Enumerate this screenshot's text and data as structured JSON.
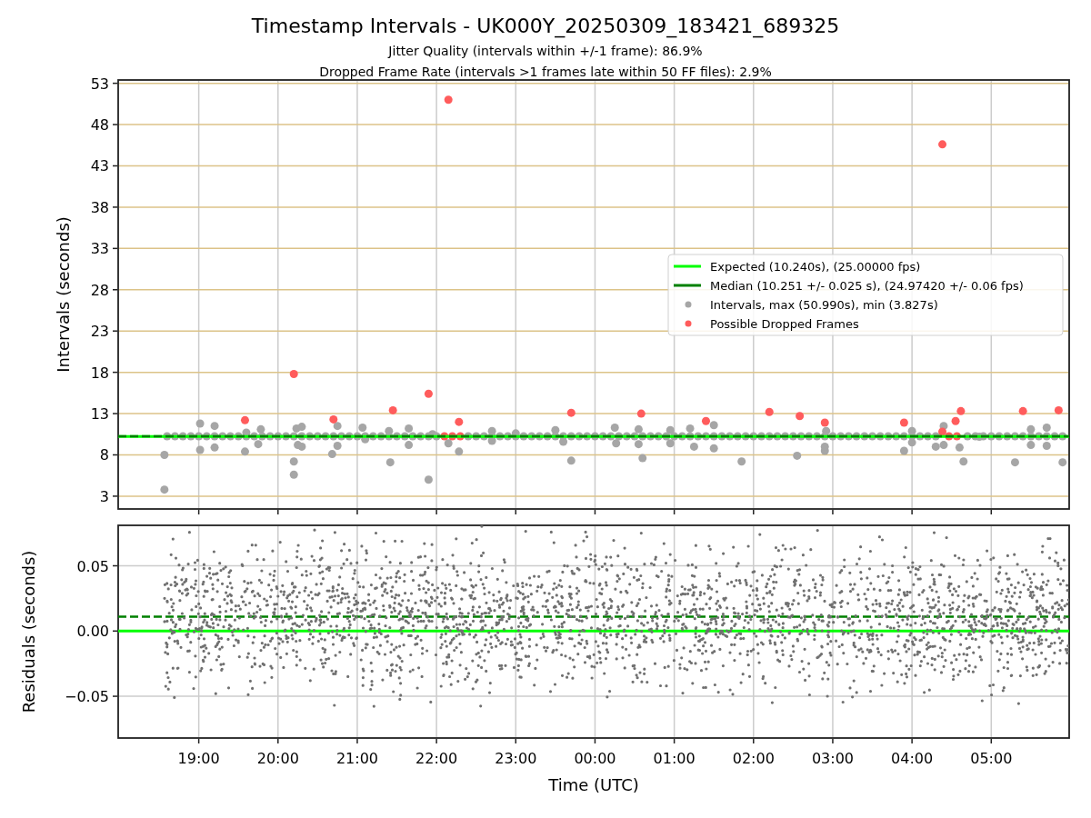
{
  "figure": {
    "title": "Timestamp Intervals - UK000Y_20250309_183421_689325",
    "subtitles": [
      "Jitter Quality (intervals within +/-1 frame): 86.9%",
      "Dropped Frame Rate (intervals >1 frames late within 50 FF files): 2.9%"
    ]
  },
  "intervals_panel": {
    "chart_data": {
      "type": "scatter",
      "ylabel": "Intervals (seconds)",
      "xlim": [
        "2025-03-09T17:59",
        "2025-03-10T05:59"
      ],
      "ylim": [
        1.45,
        53.4
      ],
      "grid": true,
      "legend": true,
      "yticks": [
        3,
        8,
        13,
        18,
        23,
        28,
        33,
        38,
        43,
        48,
        53
      ],
      "ref_lines": [
        {
          "axis": "y",
          "value": 10.24,
          "label": "Expected (10.240s), (25.00000 fps)",
          "color": "#00ff00"
        },
        {
          "axis": "y",
          "value": 10.251,
          "label": "Median (10.251 +/- 0.025 s), (24.97420 +/- 0.06 fps)",
          "color": "#008000"
        }
      ],
      "series": [
        {
          "name": "Intervals, max (50.990s), min (3.827s)",
          "color": "#a6a6a6",
          "x": [
            "2025-03-09T18:34",
            "2025-03-09T18:34",
            "2025-03-09T19:01",
            "2025-03-09T19:01",
            "2025-03-09T19:12",
            "2025-03-09T19:12",
            "2025-03-09T19:35",
            "2025-03-09T19:36",
            "2025-03-09T19:45",
            "2025-03-09T19:47",
            "2025-03-09T20:12",
            "2025-03-09T20:12",
            "2025-03-09T20:14",
            "2025-03-09T20:15",
            "2025-03-09T20:18",
            "2025-03-09T20:18",
            "2025-03-09T20:41",
            "2025-03-09T20:45",
            "2025-03-09T20:45",
            "2025-03-09T21:04",
            "2025-03-09T21:06",
            "2025-03-09T21:24",
            "2025-03-09T21:25",
            "2025-03-09T21:39",
            "2025-03-09T21:39",
            "2025-03-09T21:54",
            "2025-03-09T21:57",
            "2025-03-09T22:09",
            "2025-03-09T22:17",
            "2025-03-09T22:42",
            "2025-03-09T22:42",
            "2025-03-09T23:00",
            "2025-03-09T23:30",
            "2025-03-09T23:36",
            "2025-03-09T23:42",
            "2025-03-10T00:15",
            "2025-03-10T00:16",
            "2025-03-10T00:33",
            "2025-03-10T00:33",
            "2025-03-10T00:36",
            "2025-03-10T00:57",
            "2025-03-10T00:57",
            "2025-03-10T01:12",
            "2025-03-10T01:15",
            "2025-03-10T01:30",
            "2025-03-10T01:30",
            "2025-03-10T01:51",
            "2025-03-10T02:33",
            "2025-03-10T02:54",
            "2025-03-10T02:55",
            "2025-03-10T02:54",
            "2025-03-10T03:54",
            "2025-03-10T04:00",
            "2025-03-10T04:00",
            "2025-03-10T04:24",
            "2025-03-10T04:18",
            "2025-03-10T04:24",
            "2025-03-10T04:36",
            "2025-03-10T04:39",
            "2025-03-10T04:51",
            "2025-03-10T05:18",
            "2025-03-10T05:30",
            "2025-03-10T05:30",
            "2025-03-10T05:42",
            "2025-03-10T05:42",
            "2025-03-10T05:54",
            "2025-03-09T18:36",
            "2025-03-09T18:42",
            "2025-03-09T18:48",
            "2025-03-09T18:54",
            "2025-03-09T19:00",
            "2025-03-09T19:06",
            "2025-03-09T19:12",
            "2025-03-09T19:18",
            "2025-03-09T19:24",
            "2025-03-09T19:30",
            "2025-03-09T19:36",
            "2025-03-09T19:42",
            "2025-03-09T19:48",
            "2025-03-09T19:54",
            "2025-03-09T20:00",
            "2025-03-09T20:06",
            "2025-03-09T20:12",
            "2025-03-09T20:18",
            "2025-03-09T20:24",
            "2025-03-09T20:30",
            "2025-03-09T20:36",
            "2025-03-09T20:42",
            "2025-03-09T20:48",
            "2025-03-09T20:54",
            "2025-03-09T21:00",
            "2025-03-09T21:06",
            "2025-03-09T21:12",
            "2025-03-09T21:18",
            "2025-03-09T21:24",
            "2025-03-09T21:30",
            "2025-03-09T21:36",
            "2025-03-09T21:42",
            "2025-03-09T21:48",
            "2025-03-09T21:54",
            "2025-03-09T22:00",
            "2025-03-09T22:24",
            "2025-03-09T22:30",
            "2025-03-09T22:36",
            "2025-03-09T22:42",
            "2025-03-09T22:48",
            "2025-03-09T22:54",
            "2025-03-09T23:00",
            "2025-03-09T23:06",
            "2025-03-09T23:12",
            "2025-03-09T23:18",
            "2025-03-09T23:24",
            "2025-03-09T23:30",
            "2025-03-09T23:36",
            "2025-03-09T23:42",
            "2025-03-09T23:48",
            "2025-03-09T23:54",
            "2025-03-10T00:00",
            "2025-03-10T00:06",
            "2025-03-10T00:12",
            "2025-03-10T00:18",
            "2025-03-10T00:24",
            "2025-03-10T00:30",
            "2025-03-10T00:36",
            "2025-03-10T00:42",
            "2025-03-10T00:48",
            "2025-03-10T00:54",
            "2025-03-10T01:00",
            "2025-03-10T01:06",
            "2025-03-10T01:12",
            "2025-03-10T01:18",
            "2025-03-10T01:24",
            "2025-03-10T01:30",
            "2025-03-10T01:36",
            "2025-03-10T01:42",
            "2025-03-10T01:48",
            "2025-03-10T01:54",
            "2025-03-10T02:00",
            "2025-03-10T02:06",
            "2025-03-10T02:12",
            "2025-03-10T02:18",
            "2025-03-10T02:24",
            "2025-03-10T02:30",
            "2025-03-10T02:36",
            "2025-03-10T02:42",
            "2025-03-10T02:48",
            "2025-03-10T02:54",
            "2025-03-10T03:00",
            "2025-03-10T03:06",
            "2025-03-10T03:12",
            "2025-03-10T03:18",
            "2025-03-10T03:24",
            "2025-03-10T03:30",
            "2025-03-10T03:36",
            "2025-03-10T03:42",
            "2025-03-10T03:48",
            "2025-03-10T03:54",
            "2025-03-10T04:00",
            "2025-03-10T04:06",
            "2025-03-10T04:12",
            "2025-03-10T04:18",
            "2025-03-10T04:42",
            "2025-03-10T04:48",
            "2025-03-10T04:54",
            "2025-03-10T05:00",
            "2025-03-10T05:06",
            "2025-03-10T05:12",
            "2025-03-10T05:18",
            "2025-03-10T05:24",
            "2025-03-10T05:30",
            "2025-03-10T05:36",
            "2025-03-10T05:42",
            "2025-03-10T05:48",
            "2025-03-10T05:54"
          ],
          "values": [
            3.8,
            8.0,
            11.8,
            8.6,
            11.5,
            8.9,
            8.4,
            10.7,
            9.3,
            11.1,
            5.6,
            7.2,
            11.2,
            9.2,
            11.4,
            9.0,
            8.1,
            9.1,
            11.5,
            11.3,
            9.9,
            10.9,
            7.1,
            11.2,
            9.2,
            5.0,
            10.5,
            9.4,
            8.4,
            10.9,
            9.7,
            10.6,
            11.0,
            9.6,
            7.3,
            11.3,
            9.4,
            11.1,
            9.3,
            7.6,
            11.0,
            9.4,
            11.2,
            9.0,
            11.6,
            8.8,
            7.2,
            7.9,
            8.5,
            10.9,
            9.0,
            8.5,
            9.5,
            10.9,
            11.5,
            9.0,
            9.2,
            8.9,
            7.2,
            10.2,
            7.1,
            11.1,
            9.2,
            11.3,
            9.1,
            7.1,
            10.25,
            10.25,
            10.25,
            10.25,
            10.25,
            10.25,
            10.25,
            10.25,
            10.25,
            10.25,
            10.25,
            10.25,
            10.25,
            10.25,
            10.25,
            10.25,
            10.25,
            10.25,
            10.25,
            10.25,
            10.25,
            10.25,
            10.25,
            10.25,
            10.25,
            10.25,
            10.25,
            10.25,
            10.25,
            10.25,
            10.25,
            10.25,
            10.25,
            10.25,
            10.25,
            10.25,
            10.25,
            10.25,
            10.25,
            10.25,
            10.25,
            10.25,
            10.25,
            10.25,
            10.25,
            10.25,
            10.25,
            10.25,
            10.25,
            10.25,
            10.25,
            10.25,
            10.25,
            10.25,
            10.25,
            10.25,
            10.25,
            10.25,
            10.25,
            10.25,
            10.25,
            10.25,
            10.25,
            10.25,
            10.25,
            10.25,
            10.25,
            10.25,
            10.25,
            10.25,
            10.25,
            10.25,
            10.25,
            10.25,
            10.25,
            10.25,
            10.25,
            10.25,
            10.25,
            10.25,
            10.25,
            10.25,
            10.25,
            10.25,
            10.25,
            10.25,
            10.25,
            10.25,
            10.25,
            10.25,
            10.25,
            10.25,
            10.25,
            10.25,
            10.25,
            10.25,
            10.25,
            10.25,
            10.25,
            10.25,
            10.25,
            10.25,
            10.25,
            10.25,
            10.25,
            10.25,
            10.25,
            10.25
          ]
        },
        {
          "name": "Possible Dropped Frames",
          "color": "#ff5c5c",
          "x": [
            "2025-03-09T19:35",
            "2025-03-09T20:12",
            "2025-03-09T20:42",
            "2025-03-09T21:27",
            "2025-03-09T21:54",
            "2025-03-09T22:09",
            "2025-03-09T22:17",
            "2025-03-09T23:42",
            "2025-03-10T00:35",
            "2025-03-10T01:24",
            "2025-03-10T02:12",
            "2025-03-10T02:35",
            "2025-03-10T02:54",
            "2025-03-10T03:54",
            "2025-03-10T04:23",
            "2025-03-10T04:23",
            "2025-03-10T04:33",
            "2025-03-10T04:37",
            "2025-03-10T05:24",
            "2025-03-10T05:51",
            "2025-03-09T22:06",
            "2025-03-09T22:12",
            "2025-03-09T22:18",
            "2025-03-10T04:28",
            "2025-03-10T04:34"
          ],
          "values": [
            12.2,
            17.8,
            12.3,
            13.4,
            15.4,
            51.0,
            12.0,
            13.1,
            13.0,
            12.1,
            13.2,
            12.7,
            11.9,
            11.9,
            45.6,
            10.8,
            12.1,
            13.3,
            13.3,
            13.4,
            10.25,
            10.25,
            10.25,
            10.25,
            10.25
          ]
        }
      ]
    }
  },
  "residuals_panel": {
    "chart_data": {
      "type": "scatter",
      "ylabel": "Residuals (seconds)",
      "xlabel": "Time (UTC)",
      "xlim": [
        "2025-03-09T17:59",
        "2025-03-10T05:59"
      ],
      "ylim": [
        -0.082,
        0.081
      ],
      "xticks": [
        {
          "value": "2025-03-09T19:00",
          "label": "19:00"
        },
        {
          "value": "2025-03-09T20:00",
          "label": "20:00"
        },
        {
          "value": "2025-03-09T21:00",
          "label": "21:00"
        },
        {
          "value": "2025-03-09T22:00",
          "label": "22:00"
        },
        {
          "value": "2025-03-09T23:00",
          "label": "23:00"
        },
        {
          "value": "2025-03-10T00:00",
          "label": "00:00"
        },
        {
          "value": "2025-03-10T01:00",
          "label": "01:00"
        },
        {
          "value": "2025-03-10T02:00",
          "label": "02:00"
        },
        {
          "value": "2025-03-10T03:00",
          "label": "03:00"
        },
        {
          "value": "2025-03-10T04:00",
          "label": "04:00"
        },
        {
          "value": "2025-03-10T05:00",
          "label": "05:00"
        }
      ],
      "yticks": [
        {
          "value": 0.05,
          "label": "0.05"
        },
        {
          "value": 0,
          "label": "0.00"
        },
        {
          "value": -0.05,
          "label": "−0.05"
        }
      ],
      "grid": true,
      "ref_lines": [
        {
          "axis": "y",
          "value": 0,
          "color": "#00ff00"
        },
        {
          "axis": "y",
          "value": 0.011,
          "color": "#008000"
        }
      ]
    }
  }
}
